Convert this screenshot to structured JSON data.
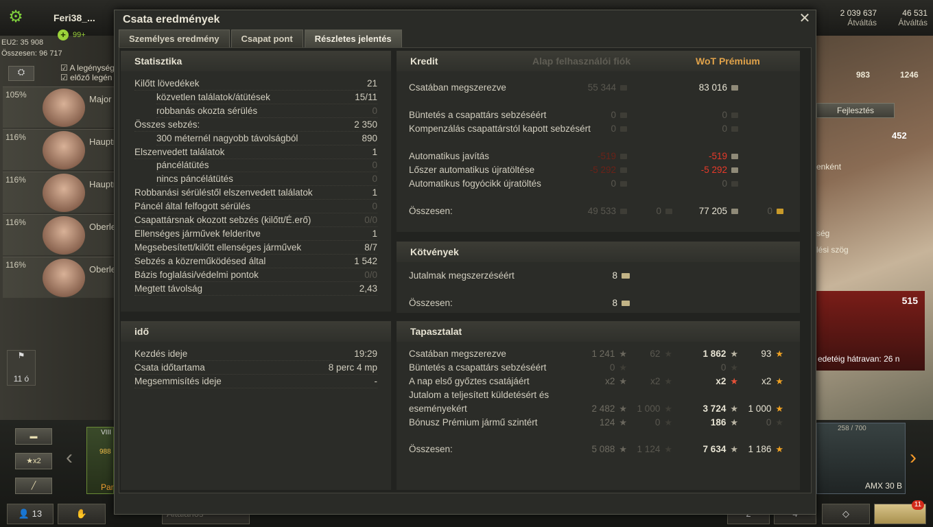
{
  "background": {
    "player_name": "Feri38_...",
    "player_badge": "99+",
    "eu2": "EU2: 35 908",
    "total": "Összesen: 96 717",
    "crew_toggle_check1": "A legénység",
    "crew_toggle_check2": "előző legén",
    "crew": [
      {
        "pct": "105%",
        "name": "Major L"
      },
      {
        "pct": "116%",
        "name": "Hauptm"
      },
      {
        "pct": "116%",
        "name": "Hauptm"
      },
      {
        "pct": "116%",
        "name": "Oberle"
      },
      {
        "pct": "116%",
        "name": "Oberle"
      }
    ],
    "credits": "2 039 637",
    "credits_action": "Átváltás",
    "gold": "46 531",
    "gold_action": "Átváltás",
    "stat_a": "983",
    "stat_b": "1246",
    "fejlesztes": "Fejlesztés",
    "scene_num": "452",
    "scene_text1": "enként",
    "scene_text2": "ség",
    "scene_text3": "lési szög",
    "red_amount": "515",
    "red_text": "edetéig hátravan: 26 n",
    "flag_count": "11 ó",
    "carousel_x2": "x2",
    "tank_mm": "258 / 700",
    "tank_name": "AMX 30 B",
    "tank_tier": "VIII",
    "tank_price": "988",
    "tank_short": "Pan",
    "bottom_count": "13",
    "bottom_chat": "Általános",
    "bottom_2": "2",
    "bottom_4": "4",
    "notif_count": "11"
  },
  "dialog": {
    "title": "Csata eredmények",
    "tabs": [
      "Személyes eredmény",
      "Csapat pont",
      "Részletes jelentés"
    ],
    "active_tab": 2
  },
  "statistika": {
    "header": "Statisztika",
    "rows": [
      {
        "label": "Kilőtt lövedékek",
        "value": "21",
        "indent": false,
        "dim": false
      },
      {
        "label": "közvetlen találatok/átütések",
        "value": "15/11",
        "indent": true,
        "dim": false
      },
      {
        "label": "robbanás okozta sérülés",
        "value": "0",
        "indent": true,
        "dim": true
      },
      {
        "label": "Összes sebzés:",
        "value": "2 350",
        "indent": false,
        "dim": false
      },
      {
        "label": "300 méternél nagyobb távolságból",
        "value": "890",
        "indent": true,
        "dim": false
      },
      {
        "label": "Elszenvedett találatok",
        "value": "1",
        "indent": false,
        "dim": false
      },
      {
        "label": "páncélátütés",
        "value": "0",
        "indent": true,
        "dim": true
      },
      {
        "label": "nincs páncélátütés",
        "value": "0",
        "indent": true,
        "dim": true
      },
      {
        "label": "Robbanási sérüléstől elszenvedett találatok",
        "value": "1",
        "indent": false,
        "dim": false
      },
      {
        "label": "Páncél által felfogott sérülés",
        "value": "0",
        "indent": false,
        "dim": true
      },
      {
        "label": "Csapattársnak okozott sebzés (kilőtt/É.erő)",
        "value": "0/0",
        "indent": false,
        "dim": true
      },
      {
        "label": "Ellenséges járművek felderítve",
        "value": "1",
        "indent": false,
        "dim": false
      },
      {
        "label": "Megsebesített/kilőtt ellenséges járművek",
        "value": "8/7",
        "indent": false,
        "dim": false
      },
      {
        "label": "Sebzés a közreműködésed által",
        "value": "1 542",
        "indent": false,
        "dim": false
      },
      {
        "label": "Bázis foglalási/védelmi pontok",
        "value": "0/0",
        "indent": false,
        "dim": true
      },
      {
        "label": "Megtett távolság",
        "value": "2,43",
        "indent": false,
        "dim": false
      }
    ]
  },
  "ido": {
    "header": "idő",
    "rows": [
      {
        "label": "Kezdés ideje",
        "value": "19:29"
      },
      {
        "label": "Csata időtartama",
        "value": "8 perc 4 mp"
      },
      {
        "label": "Megsemmisítés ideje",
        "value": "-"
      }
    ]
  },
  "kredit": {
    "header": "Kredit",
    "col_basic": "Alap felhasználói fiók",
    "col_premium": "WoT Prémium",
    "rows": [
      {
        "label": "Csatában megszerezve",
        "basic": "55 344",
        "basic_gold": "",
        "prem": "83 016",
        "prem_gold": ""
      },
      {
        "label": "Büntetés a csapattárs sebzéséért",
        "basic": "0",
        "basic_gold": "",
        "prem": "0",
        "prem_gold": ""
      },
      {
        "label": "Kompenzálás csapattárstól kapott sebzésért",
        "basic": "0",
        "basic_gold": "",
        "prem": "0",
        "prem_gold": ""
      },
      {
        "label": "Automatikus javítás",
        "basic": "-519",
        "basic_gold": "",
        "prem": "-519",
        "prem_gold": ""
      },
      {
        "label": "Lőszer automatikus újratöltése",
        "basic": "-5 292",
        "basic_gold": "",
        "prem": "-5 292",
        "prem_gold": ""
      },
      {
        "label": "Automatikus fogyócikk újratöltés",
        "basic": "0",
        "basic_gold": "",
        "prem": "0",
        "prem_gold": ""
      },
      {
        "label": "Összesen:",
        "basic": "49 533",
        "basic_gold": "0",
        "prem": "77 205",
        "prem_gold": "0"
      }
    ]
  },
  "kotvenyek": {
    "header": "Kötvények",
    "rows": [
      {
        "label": "Jutalmak megszerzéséért",
        "value": "8"
      },
      {
        "label": "Összesen:",
        "value": "8"
      }
    ]
  },
  "tapasztalat": {
    "header": "Tapasztalat",
    "rows": [
      {
        "label": "Csatában megszerezve",
        "b1": "1 241",
        "b2": "62",
        "p1": "1 862",
        "p2": "93"
      },
      {
        "label": "Büntetés a csapattárs sebzéséért",
        "b1": "0",
        "b2": "",
        "p1": "0",
        "p2": ""
      },
      {
        "label": "A nap első győztes csatájáért",
        "b1": "x2",
        "b2": "x2",
        "p1": "x2",
        "p2": "x2"
      },
      {
        "label": "Jutalom a teljesített küldetésért és",
        "b1": "",
        "b2": "",
        "p1": "",
        "p2": ""
      },
      {
        "label": "eseményekért",
        "b1": "2 482",
        "b2": "1 000",
        "p1": "3 724",
        "p2": "1 000"
      },
      {
        "label": "Bónusz Prémium jármű szintért",
        "b1": "124",
        "b2": "0",
        "p1": "186",
        "p2": "0"
      },
      {
        "label": "Összesen:",
        "b1": "5 088",
        "b2": "1 124",
        "p1": "7 634",
        "p2": "1 186"
      }
    ]
  }
}
